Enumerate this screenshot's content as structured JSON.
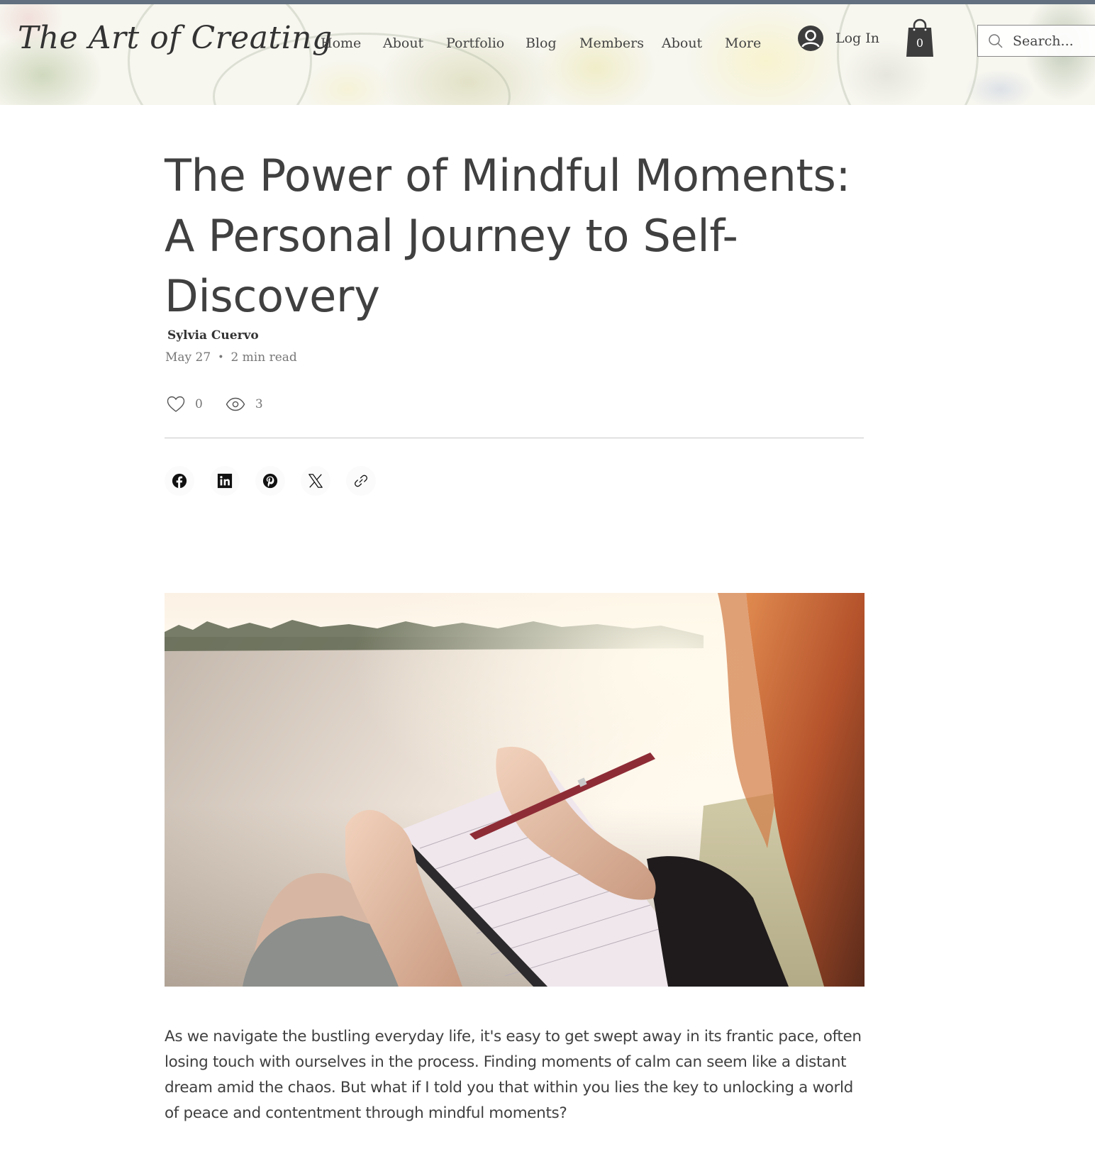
{
  "site": {
    "logo": "The Art of Creating",
    "nav": [
      "Home",
      "About",
      "Portfolio",
      "Blog",
      "Members",
      "About",
      "More"
    ],
    "login_label": "Log In",
    "cart_count": "0",
    "search_placeholder": "Search...",
    "colors": {
      "topbar": "#627080",
      "text": "#404040",
      "muted": "#777777"
    }
  },
  "post": {
    "title": "The Power of Mindful Moments: A Personal Journey to Self-Discovery",
    "author": "Sylvia Cuervo",
    "date": "May 27",
    "separator": "•",
    "read_time": "2 min read",
    "likes": "0",
    "views": "3",
    "share": [
      {
        "network": "facebook",
        "icon": "facebook-icon"
      },
      {
        "network": "linkedin",
        "icon": "linkedin-icon"
      },
      {
        "network": "pinterest",
        "icon": "pinterest-icon"
      },
      {
        "network": "x",
        "icon": "x-icon"
      },
      {
        "network": "copy-link",
        "icon": "link-icon"
      }
    ],
    "image_alt": "Woman writing in a spiral notebook with a red pen beside a lake at sunset",
    "paragraph": "As we navigate the bustling everyday life, it's easy to get swept away in its frantic pace, often losing touch with ourselves in the process. Finding moments of calm can seem like a distant dream amid the chaos. But what if I told you that within you lies the key to unlocking a world of peace and contentment through mindful moments?"
  }
}
